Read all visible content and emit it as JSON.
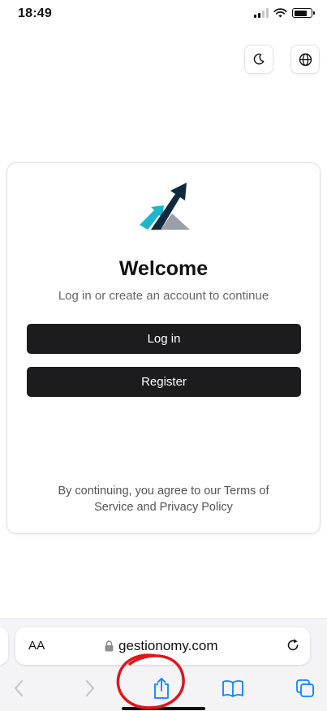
{
  "status_bar": {
    "time": "18:49"
  },
  "header": {
    "theme_icon": "moon-icon",
    "language_icon": "globe-icon"
  },
  "card": {
    "title": "Welcome",
    "subtitle": "Log in or create an account to continue",
    "login_label": "Log in",
    "register_label": "Register",
    "terms": "By continuing, you agree to our Terms of Service and Privacy Policy"
  },
  "browser": {
    "aa_label": "AA",
    "url": "gestionomy.com",
    "toolbar_icons": [
      "back-icon",
      "forward-icon",
      "share-icon",
      "bookmarks-icon",
      "tabs-icon"
    ]
  },
  "colors": {
    "button_bg": "#1c1c1e",
    "accent_blue": "#0a84ff",
    "logo_teal": "#1fb5c9",
    "logo_navy": "#0f2a3f",
    "logo_gray": "#9a9ea6",
    "annotation_red": "#e3141b"
  }
}
